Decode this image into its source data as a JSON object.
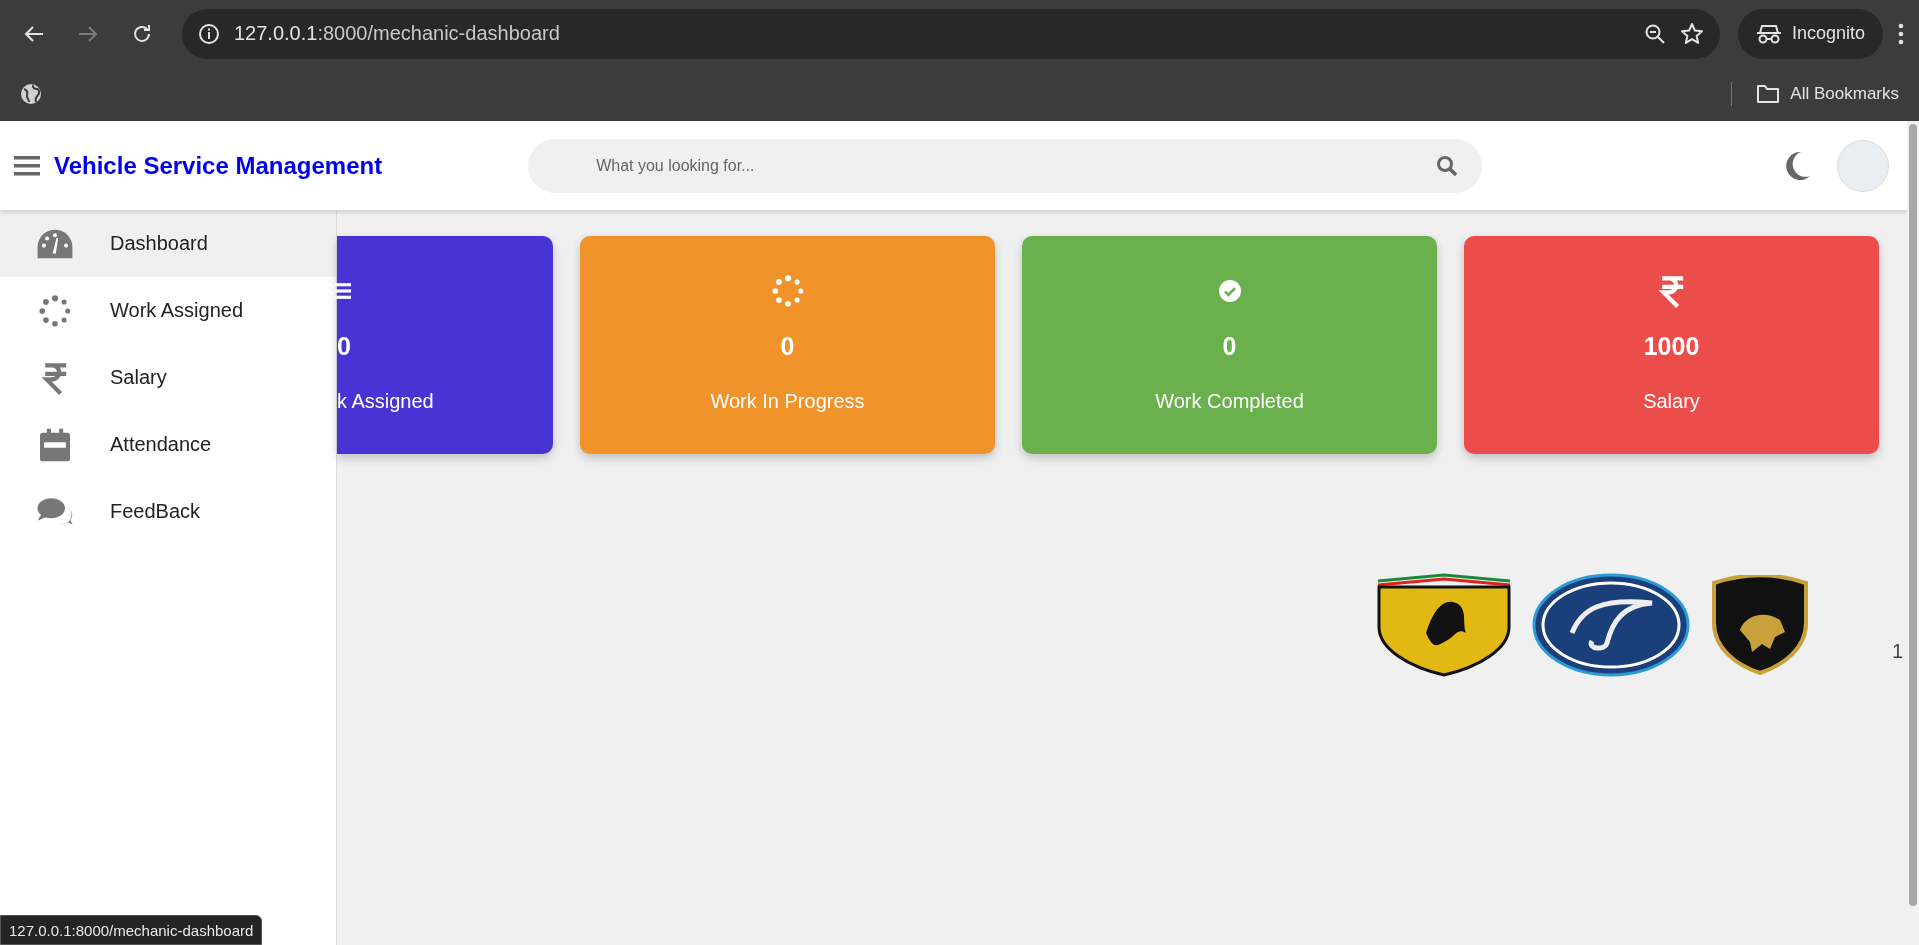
{
  "browser": {
    "back_disabled": false,
    "forward_disabled": true,
    "url_host": "127.0.0.1",
    "url_path": ":8000/mechanic-dashboard",
    "profile": "Incognito",
    "bookmarks_folder": "All Bookmarks"
  },
  "header": {
    "title": "Vehicle Service Management",
    "search": {
      "placeholder": "What you looking for..."
    }
  },
  "sidebar": {
    "items": [
      {
        "label": "Dashboard",
        "kind": "gauge",
        "selected": true
      },
      {
        "label": "Work Assigned",
        "kind": "spinner",
        "selected": false
      },
      {
        "label": "Salary",
        "kind": "rupee",
        "selected": false
      },
      {
        "label": "Attendance",
        "kind": "calendar",
        "selected": false
      },
      {
        "label": "FeedBack",
        "kind": "comments",
        "selected": false
      }
    ]
  },
  "cards": [
    {
      "kind": "list",
      "value": "0",
      "label": "k Assigned",
      "color": "#4834d4",
      "partial": true
    },
    {
      "kind": "spinner",
      "value": "0",
      "label": "Work In Progress",
      "color": "#f0932b",
      "partial": false
    },
    {
      "kind": "check",
      "value": "0",
      "label": "Work Completed",
      "color": "#6ab04c",
      "partial": false
    },
    {
      "kind": "rupee",
      "value": "1000",
      "label": "Salary",
      "color": "#eb4d4b",
      "partial": false
    }
  ],
  "logos": [
    {
      "kind": "shield"
    },
    {
      "kind": "oval"
    },
    {
      "kind": "crest"
    }
  ],
  "page_number": "1",
  "status_url": "127.0.0.1:8000/mechanic-dashboard"
}
